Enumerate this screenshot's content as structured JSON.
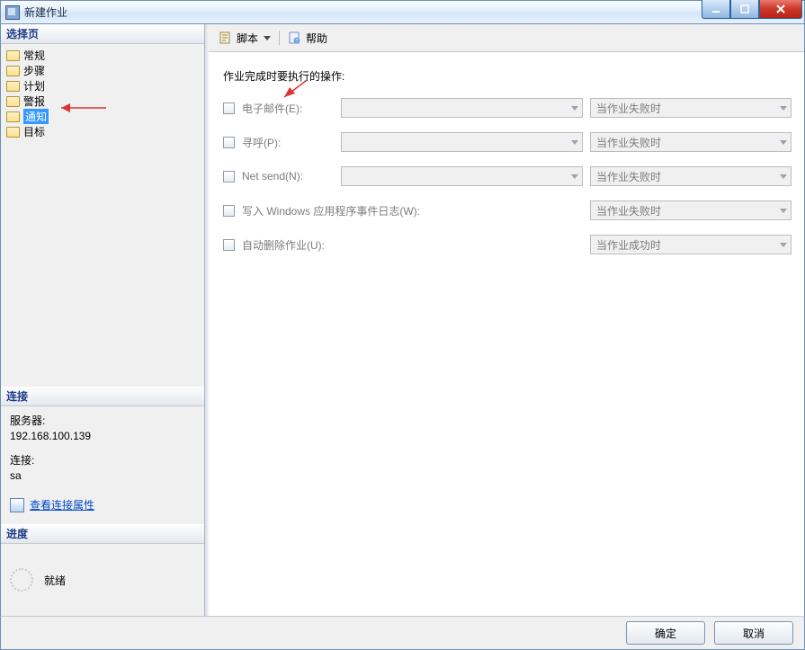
{
  "window": {
    "title": "新建作业"
  },
  "titlebar_controls": {
    "minimize": "minimize",
    "maximize": "maximize",
    "close": "close"
  },
  "left": {
    "select_page_header": "选择页",
    "nav_items": [
      {
        "label": "常规",
        "selected": false
      },
      {
        "label": "步骤",
        "selected": false
      },
      {
        "label": "计划",
        "selected": false
      },
      {
        "label": "警报",
        "selected": false
      },
      {
        "label": "通知",
        "selected": true
      },
      {
        "label": "目标",
        "selected": false
      }
    ],
    "connection_header": "连接",
    "connection": {
      "server_label": "服务器:",
      "server_value": "192.168.100.139",
      "conn_label": "连接:",
      "conn_value": "sa",
      "view_props": "查看连接属性"
    },
    "progress_header": "进度",
    "progress_status": "就绪"
  },
  "toolbar": {
    "script_label": "脚本",
    "help_label": "帮助"
  },
  "form": {
    "heading": "作业完成时要执行的操作:",
    "rows": {
      "email": {
        "label": "电子邮件(E):",
        "option": "当作业失败时"
      },
      "pager": {
        "label": "寻呼(P):",
        "option": "当作业失败时"
      },
      "netsend": {
        "label": "Net send(N):",
        "option": "当作业失败时"
      },
      "eventlog": {
        "label": "写入 Windows 应用程序事件日志(W):",
        "option": "当作业失败时"
      },
      "autodelete": {
        "label": "自动删除作业(U):",
        "option": "当作业成功时"
      }
    }
  },
  "footer": {
    "ok": "确定",
    "cancel": "取消"
  }
}
